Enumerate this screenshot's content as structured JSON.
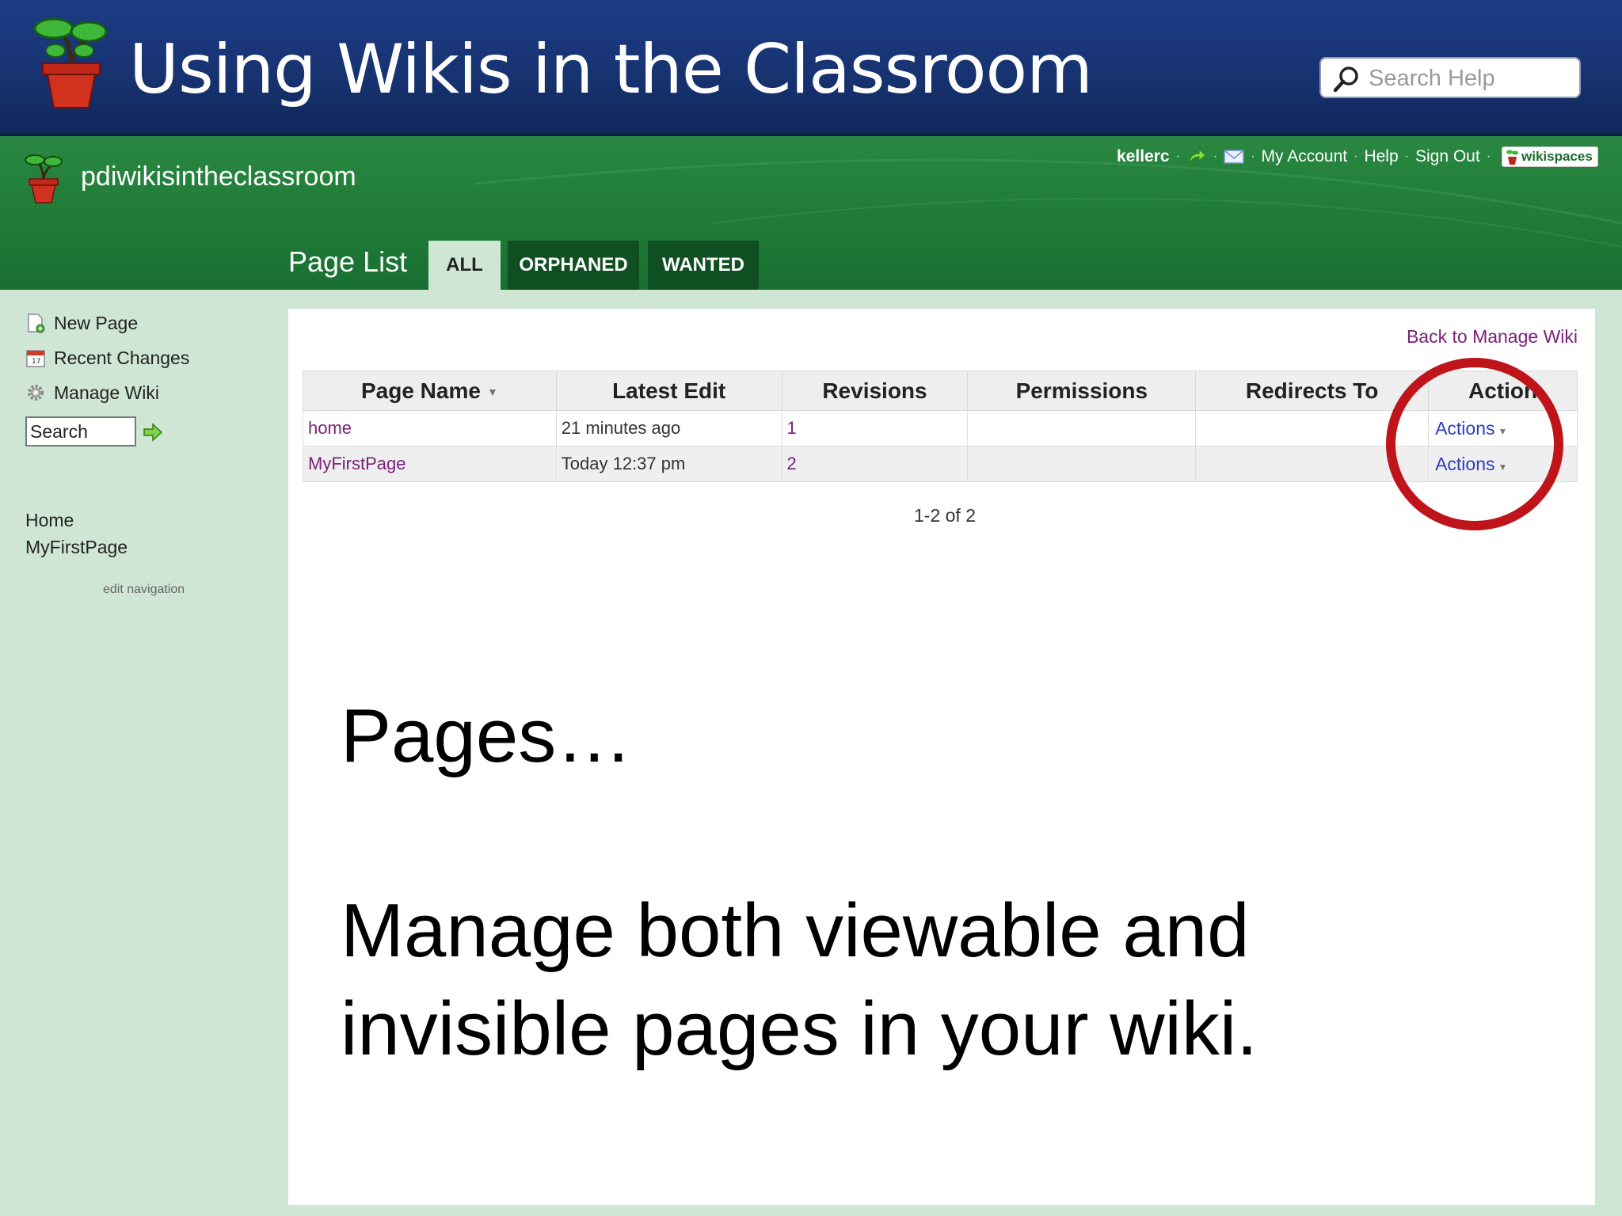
{
  "slide": {
    "title": "Using Wikis in the Classroom",
    "help_search_placeholder": "Search Help"
  },
  "wiki": {
    "name": "pdiwikisintheclassroom",
    "user": "kellerc",
    "links": [
      "My Account",
      "Help",
      "Sign Out"
    ],
    "brand": "wikispaces",
    "section_title": "Page List",
    "tabs": [
      {
        "label": "ALL",
        "active": true
      },
      {
        "label": "ORPHANED",
        "active": false
      },
      {
        "label": "WANTED",
        "active": false
      }
    ]
  },
  "sidebar": {
    "items": [
      {
        "label": "New Page",
        "icon": "new-page-icon"
      },
      {
        "label": "Recent Changes",
        "icon": "calendar-icon"
      },
      {
        "label": "Manage Wiki",
        "icon": "gear-icon"
      }
    ],
    "search_value": "Search",
    "nav_links": [
      "Home",
      "MyFirstPage"
    ],
    "edit_navigation": "edit navigation"
  },
  "content": {
    "back_link": "Back to Manage Wiki",
    "columns": [
      "Page Name",
      "Latest Edit",
      "Revisions",
      "Permissions",
      "Redirects To",
      "Action"
    ],
    "rows": [
      {
        "page": "home",
        "latest_edit": "21 minutes ago",
        "revisions": "1",
        "permissions": "",
        "redirects": "",
        "action": "Actions"
      },
      {
        "page": "MyFirstPage",
        "latest_edit": "Today 12:37 pm",
        "revisions": "2",
        "permissions": "",
        "redirects": "",
        "action": "Actions"
      }
    ],
    "pager": "1-2 of 2"
  },
  "caption": {
    "line1": "Pages…",
    "line2": "Manage both viewable and invisible pages in your wiki."
  },
  "colors": {
    "slide_header": "#173371",
    "wiki_green": "#1e7a36",
    "link_purple": "#7a2178",
    "action_blue": "#2a3dbf",
    "highlight_red": "#c0141b"
  }
}
